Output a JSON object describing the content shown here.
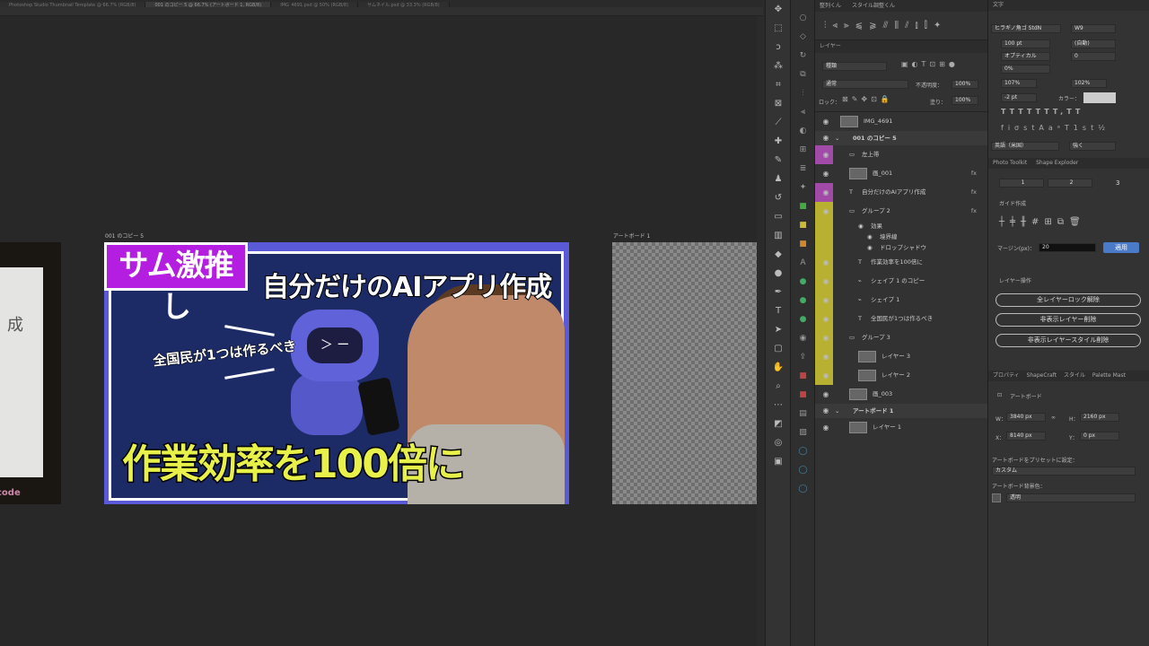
{
  "tabs": [
    {
      "label": "Photoshop Studio Thumbnail Template @ 66.7% (RGB/8)",
      "active": false
    },
    {
      "label": "001 のコピー 5 @ 66.7% (アートボード 1, RGB/8)",
      "active": true
    },
    {
      "label": "IMG_4691.psd @ 50% (RGB/8)",
      "active": false
    },
    {
      "label": "サムネイル.psd @ 33.3% (RGB/8)",
      "active": false
    }
  ],
  "canvas": {
    "artboard_left_label": "001 のコピー 5",
    "artboard_right_label": "アートボード 1",
    "left_art_text": "成",
    "left_art_code": "code",
    "thumbnail": {
      "badge": "サム激推し",
      "title": "自分だけのAIアプリ作成",
      "subtitle": "全国民が1つは作るべき",
      "main": "作業効率を100倍に",
      "robot_face": "＞ ー"
    }
  },
  "top_toolbar_tabs": [
    "整列くん",
    "スタイル調整くん"
  ],
  "layers_panel": {
    "tab": "レイヤー",
    "filter_kind": "種類",
    "blend_mode": "通常",
    "opacity_label": "不透明度：",
    "opacity_value": "100%",
    "lock_label": "ロック：",
    "fill_label": "塗り：",
    "fill_value": "100%",
    "layers": [
      {
        "name": "IMG_4691",
        "indent": 0,
        "color": "",
        "visible": true,
        "fx": false,
        "kind": "image"
      },
      {
        "name": "001 のコピー 5",
        "indent": 0,
        "color": "",
        "visible": true,
        "fx": false,
        "kind": "artboard"
      },
      {
        "name": "左上帯",
        "indent": 1,
        "color": "#a24aa8",
        "visible": true,
        "fx": false,
        "kind": "group"
      },
      {
        "name": "画_001",
        "indent": 1,
        "color": "",
        "visible": true,
        "fx": true,
        "kind": "image"
      },
      {
        "name": "自分だけのAIアプリ作成",
        "indent": 1,
        "color": "#a24aa8",
        "visible": true,
        "fx": true,
        "kind": "text"
      },
      {
        "name": "グループ 2",
        "indent": 1,
        "color": "#b8b030",
        "visible": true,
        "fx": true,
        "kind": "group"
      },
      {
        "name": "効果",
        "indent": 2,
        "color": "#b8b030",
        "visible": true,
        "fx": false,
        "kind": "effect"
      },
      {
        "name": "境界線",
        "indent": 3,
        "color": "#b8b030",
        "visible": true,
        "fx": false,
        "kind": "effect"
      },
      {
        "name": "ドロップシャドウ",
        "indent": 3,
        "color": "#b8b030",
        "visible": true,
        "fx": false,
        "kind": "effect"
      },
      {
        "name": "作業効率を100倍に",
        "indent": 2,
        "color": "#b8b030",
        "visible": true,
        "fx": false,
        "kind": "text"
      },
      {
        "name": "シェイプ 1 のコピー",
        "indent": 2,
        "color": "#b8b030",
        "visible": true,
        "fx": false,
        "kind": "shape"
      },
      {
        "name": "シェイプ 1",
        "indent": 2,
        "color": "#b8b030",
        "visible": true,
        "fx": false,
        "kind": "shape"
      },
      {
        "name": "全国民が1つは作るべき",
        "indent": 2,
        "color": "#b8b030",
        "visible": true,
        "fx": false,
        "kind": "text"
      },
      {
        "name": "グループ 3",
        "indent": 1,
        "color": "#b8b030",
        "visible": true,
        "fx": false,
        "kind": "group"
      },
      {
        "name": "レイヤー 3",
        "indent": 2,
        "color": "#b8b030",
        "visible": true,
        "fx": false,
        "kind": "image"
      },
      {
        "name": "レイヤー 2",
        "indent": 2,
        "color": "#b8b030",
        "visible": true,
        "fx": false,
        "kind": "image"
      },
      {
        "name": "画_003",
        "indent": 1,
        "color": "",
        "visible": true,
        "fx": false,
        "kind": "image"
      },
      {
        "name": "アートボード 1",
        "indent": 0,
        "color": "",
        "visible": true,
        "fx": false,
        "kind": "artboard"
      },
      {
        "name": "レイヤー 1",
        "indent": 1,
        "color": "",
        "visible": true,
        "fx": false,
        "kind": "image"
      }
    ]
  },
  "text_panel": {
    "tab": "文字",
    "font": "ヒラギノ角ゴ StdN",
    "weight": "W9",
    "size": "100 pt",
    "leading": "(自動)",
    "kerning": "オプティカル",
    "tracking": "0",
    "scale_pct": "0%",
    "vscale": "107%",
    "hscale": "102%",
    "baseline": "-2 pt",
    "color_label": "カラー：",
    "language": "英語（米国）",
    "aa": "強く"
  },
  "photo_toolkit": {
    "tabs": [
      "Photo Toolkit",
      "Shape Exploder"
    ],
    "cols": [
      "1",
      "2",
      "3"
    ],
    "guide_label": "ガイド作成",
    "margin_label": "マージン(px)：",
    "margin_value": "20",
    "apply": "適用",
    "layer_ops_label": "レイヤー操作",
    "btn_unlock": "全レイヤーロック解除",
    "btn_delete_hidden": "非表示レイヤー削除",
    "btn_delete_styles": "非表示レイヤースタイル削除"
  },
  "properties": {
    "tabs": [
      "プロパティ",
      "ShapeCraft",
      "スタイル",
      "Palette Mast"
    ],
    "kind": "アートボード",
    "w_label": "W：",
    "w": "3840 px",
    "h_label": "H：",
    "h": "2160 px",
    "x_label": "X：",
    "x": "8140 px",
    "y_label": "Y：",
    "y": "0 px",
    "preset_label": "アートボードをプリセットに設定：",
    "preset": "カスタム",
    "bg_label": "アートボード背景色：",
    "bg": "透明"
  },
  "colors": {
    "purple_tag": "#a24aa8",
    "yellow_tag": "#b8b030",
    "apply_button": "#4a7ac8"
  }
}
